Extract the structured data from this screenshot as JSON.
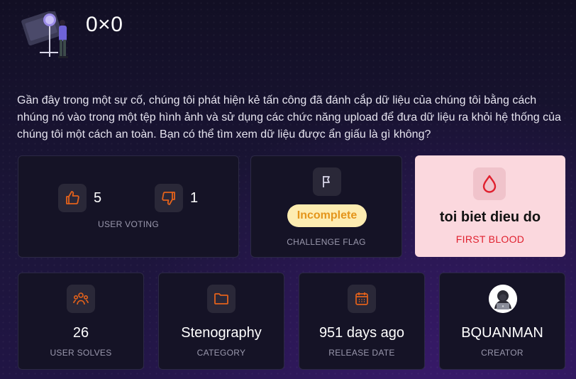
{
  "challenge": {
    "title": "0×0",
    "description": "Gần đây trong một sự cố, chúng tôi phát hiện kẻ tấn công đã đánh cắp dữ liệu của chúng tôi bằng cách nhúng nó vào trong một tệp hình ảnh và sử dụng các chức năng upload để đưa dữ liệu ra khỏi hệ thống của chúng tôi một cách an toàn. Bạn có thể tìm xem dữ liệu được ẩn giấu là gì không?"
  },
  "voting": {
    "likes": "5",
    "dislikes": "1",
    "caption": "USER VOTING",
    "like_icon": "thumbs-up-icon",
    "dislike_icon": "thumbs-down-icon"
  },
  "flag": {
    "status": "Incomplete",
    "caption": "CHALLENGE FLAG",
    "icon": "flag-icon"
  },
  "first_blood": {
    "user": "toi biet dieu do",
    "caption": "FIRST BLOOD",
    "icon": "blood-drop-icon"
  },
  "stats": {
    "solves": {
      "value": "26",
      "caption": "USER SOLVES",
      "icon": "users-icon"
    },
    "category": {
      "value": "Stenography",
      "caption": "CATEGORY",
      "icon": "folder-icon"
    },
    "release": {
      "value": "951 days ago",
      "caption": "RELEASE DATE",
      "icon": "calendar-icon"
    },
    "creator": {
      "value": "BQUANMAN",
      "caption": "CREATOR",
      "icon": "hacker-avatar"
    }
  },
  "colors": {
    "accent_orange": "#e4621b",
    "blood_red": "#e0202e",
    "card_bg": "#151326",
    "incomplete_bg": "#fdecb1",
    "first_blood_bg": "#fbd8de"
  }
}
